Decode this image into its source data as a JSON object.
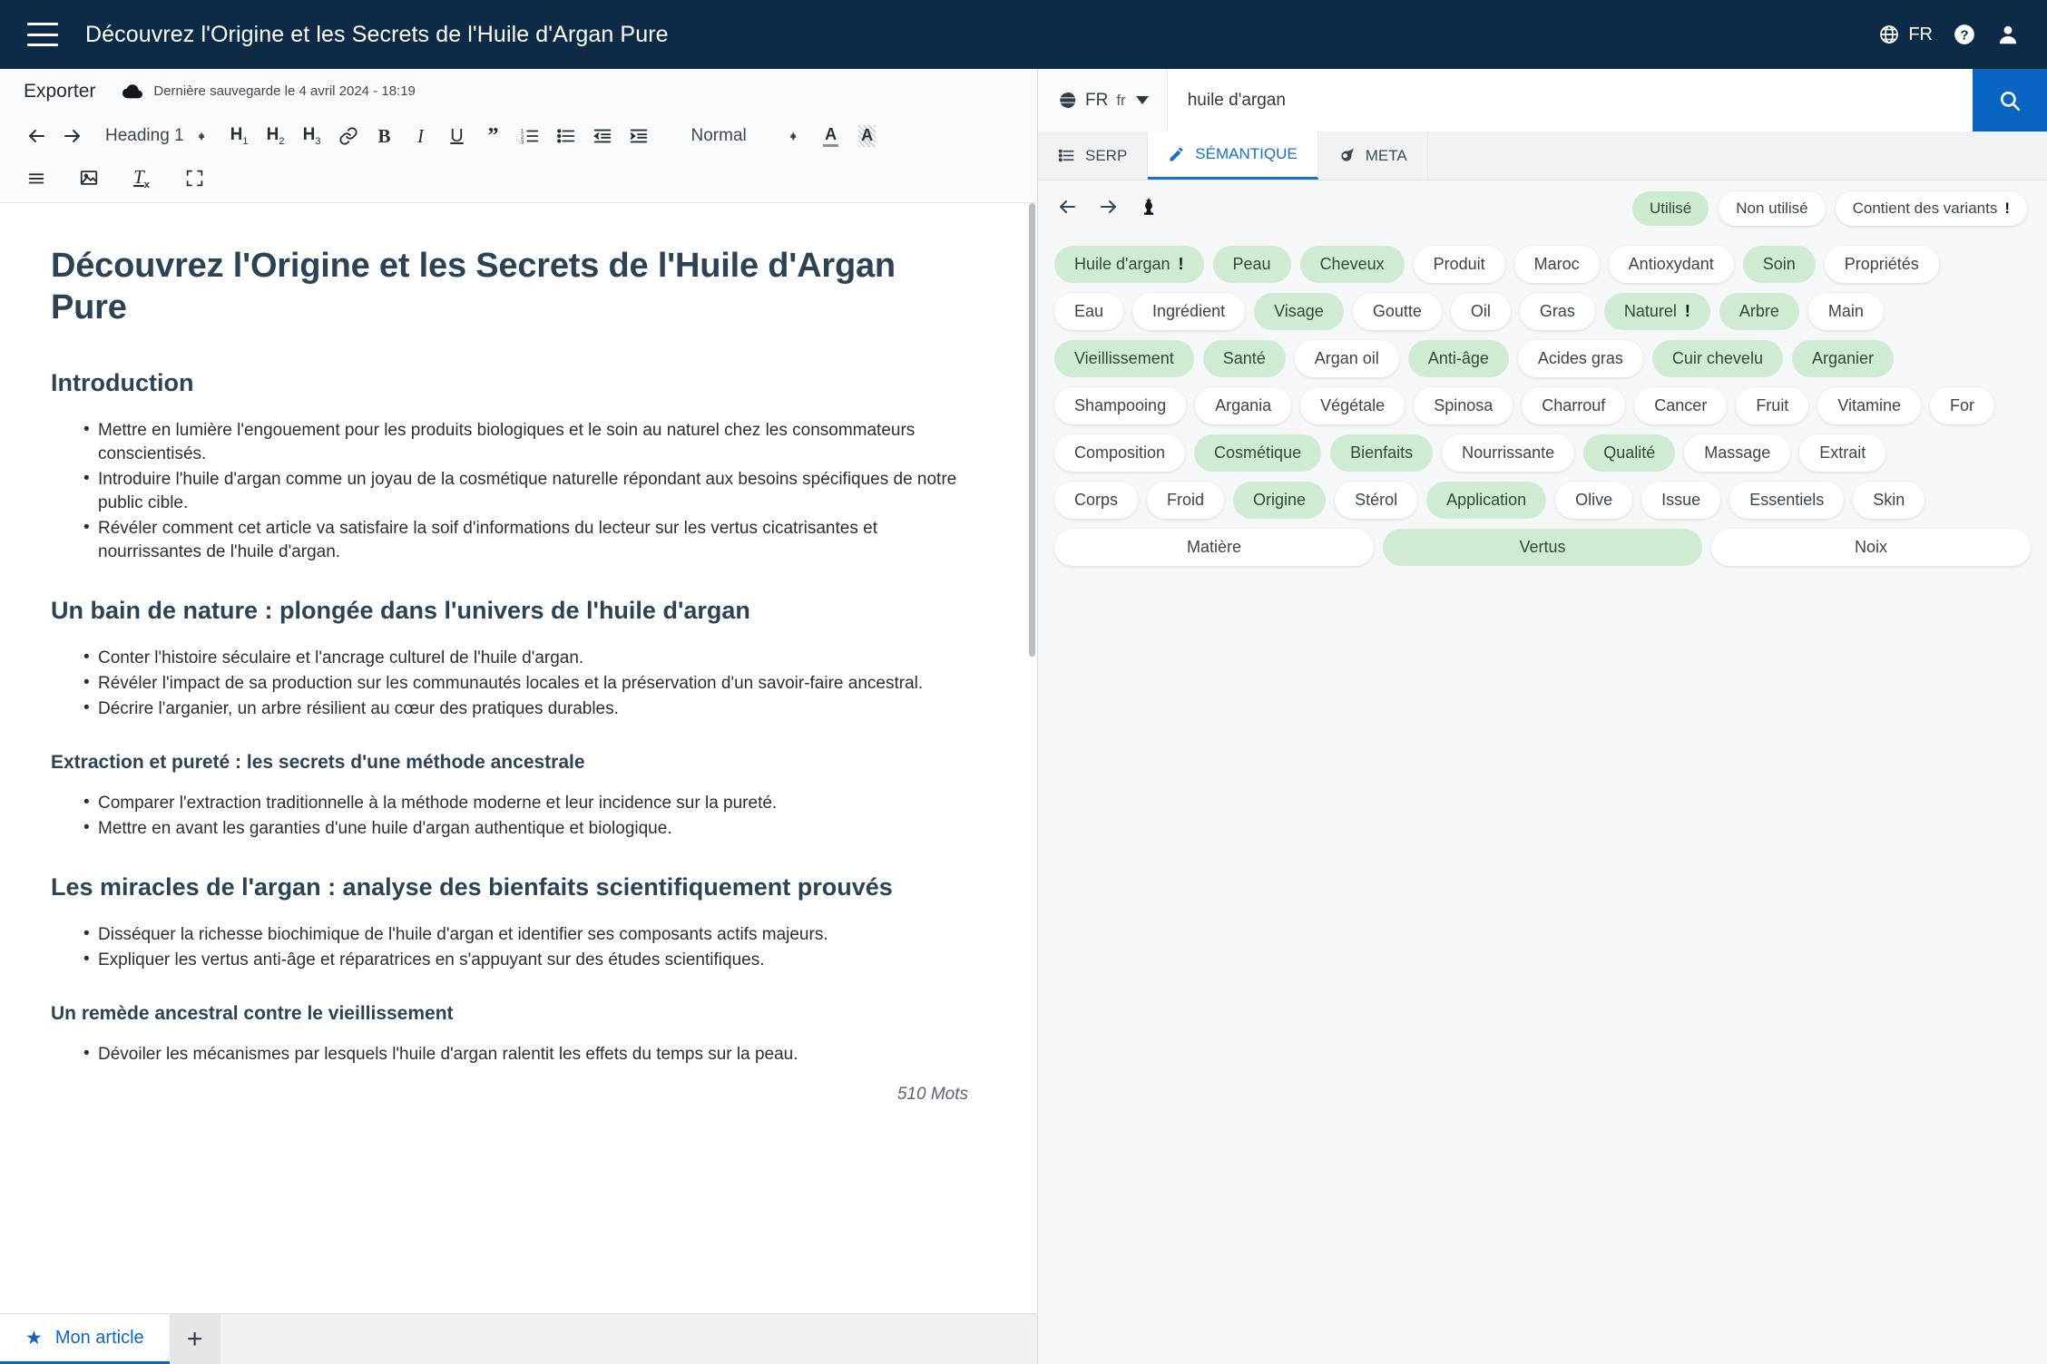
{
  "header": {
    "menu_icon": "hamburger-icon",
    "title": "Découvrez l'Origine et les Secrets de l'Huile d'Argan Pure",
    "lang": "FR",
    "globe_icon": "globe-icon",
    "help_icon": "help-circle-icon",
    "account_icon": "user-icon"
  },
  "editor": {
    "export_label": "Exporter",
    "save_status": "Dernière sauvegarde le 4 avril 2024 - 18:19",
    "cloud_icon": "cloud-icon",
    "toolbar": {
      "undo": "undo-arrow-icon",
      "redo": "redo-arrow-icon",
      "heading_select": "Heading 1",
      "h1": "H1",
      "h2": "H2",
      "h3": "H3",
      "link": "link-icon",
      "bold": "B",
      "italic": "I",
      "underline": "U",
      "quote": "”",
      "ordered_list": "ordered-list-icon",
      "bullet_list": "bullet-list-icon",
      "outdent": "outdent-icon",
      "indent": "indent-icon",
      "format_select": "Normal",
      "text_color": "A",
      "highlight": "A",
      "align": "align-icon",
      "image": "image-icon",
      "clear_format": "clear-format-icon",
      "fullscreen": "fullscreen-icon"
    },
    "document": {
      "title": "Découvrez l'Origine et les Secrets de l'Huile d'Argan Pure",
      "sections": [
        {
          "level": 2,
          "heading": "Introduction",
          "bullets": [
            "Mettre en lumière l'engouement pour les produits biologiques et le soin au naturel chez les consommateurs conscientisés.",
            "Introduire l'huile d'argan comme un joyau de la cosmétique naturelle répondant aux besoins spécifiques de notre public cible.",
            "Révéler comment cet article va satisfaire la soif d'informations du lecteur sur les vertus cicatrisantes et nourrissantes de l'huile d'argan."
          ]
        },
        {
          "level": 2,
          "heading": "Un bain de nature : plongée dans l'univers de l'huile d'argan",
          "bullets": [
            "Conter l'histoire séculaire et l'ancrage culturel de l'huile d'argan.",
            "Révéler l'impact de sa production sur les communautés locales et la préservation d'un savoir-faire ancestral.",
            "Décrire l'arganier, un arbre résilient au cœur des pratiques durables."
          ]
        },
        {
          "level": 3,
          "heading": "Extraction et pureté : les secrets d'une méthode ancestrale",
          "bullets": [
            "Comparer l'extraction traditionnelle à la méthode moderne et leur incidence sur la pureté.",
            "Mettre en avant les garanties d'une huile d'argan authentique et biologique."
          ]
        },
        {
          "level": 2,
          "heading": "Les miracles de l'argan : analyse des bienfaits scientifiquement prouvés",
          "bullets": [
            "Disséquer la richesse biochimique de l'huile d'argan et identifier ses composants actifs majeurs.",
            "Expliquer les vertus anti-âge et réparatrices en s'appuyant sur des études scientifiques."
          ]
        },
        {
          "level": 3,
          "heading": "Un remède ancestral contre le vieillissement",
          "bullets": [
            "Dévoiler les mécanismes par lesquels l'huile d'argan ralentit les effets du temps sur la peau."
          ]
        }
      ],
      "word_count": "510 Mots"
    },
    "tabs": {
      "article_label": "Mon article",
      "star_icon": "star-icon",
      "add_label": "+"
    }
  },
  "panel": {
    "search": {
      "lang_code": "FR",
      "lang_sub": "fr",
      "globe_icon": "globe-icon",
      "query": "huile d'argan",
      "search_icon": "search-icon"
    },
    "tabs": [
      {
        "label": "SERP",
        "icon": "list-icon",
        "active": false
      },
      {
        "label": "SÉMANTIQUE",
        "icon": "pencil-icon",
        "active": true
      },
      {
        "label": "META",
        "icon": "comet-icon",
        "active": false
      }
    ],
    "filters": {
      "back_icon": "arrow-left-icon",
      "forward_icon": "arrow-right-icon",
      "chess_icon": "chess-pawn-icon",
      "chips": [
        {
          "label": "Utilisé",
          "on": true,
          "warn": false
        },
        {
          "label": "Non utilisé",
          "on": false,
          "warn": false
        },
        {
          "label": "Contient des variants",
          "on": false,
          "warn": true
        }
      ]
    },
    "keyword_rows": [
      [
        {
          "label": "Huile d'argan",
          "used": true,
          "warn": true
        },
        {
          "label": "Peau",
          "used": true,
          "warn": false
        },
        {
          "label": "Cheveux",
          "used": true,
          "warn": false
        },
        {
          "label": "Produit",
          "used": false,
          "warn": false
        },
        {
          "label": "Maroc",
          "used": false,
          "warn": false
        },
        {
          "label": "Antioxydant",
          "used": false,
          "warn": false
        },
        {
          "label": "Soin",
          "used": true,
          "warn": false
        },
        {
          "label": "Propriétés",
          "used": false,
          "warn": false
        }
      ],
      [
        {
          "label": "Eau",
          "used": false,
          "warn": false
        },
        {
          "label": "Ingrédient",
          "used": false,
          "warn": false
        },
        {
          "label": "Visage",
          "used": true,
          "warn": false
        },
        {
          "label": "Goutte",
          "used": false,
          "warn": false
        },
        {
          "label": "Oil",
          "used": false,
          "warn": false
        },
        {
          "label": "Gras",
          "used": false,
          "warn": false
        },
        {
          "label": "Naturel",
          "used": true,
          "warn": true
        },
        {
          "label": "Arbre",
          "used": true,
          "warn": false
        },
        {
          "label": "Main",
          "used": false,
          "warn": false
        }
      ],
      [
        {
          "label": "Vieillissement",
          "used": true,
          "warn": false
        },
        {
          "label": "Santé",
          "used": true,
          "warn": false
        },
        {
          "label": "Argan oil",
          "used": false,
          "warn": false
        },
        {
          "label": "Anti-âge",
          "used": true,
          "warn": false
        },
        {
          "label": "Acides gras",
          "used": false,
          "warn": false
        },
        {
          "label": "Cuir chevelu",
          "used": true,
          "warn": false
        },
        {
          "label": "Arganier",
          "used": true,
          "warn": false
        }
      ],
      [
        {
          "label": "Shampooing",
          "used": false,
          "warn": false
        },
        {
          "label": "Argania",
          "used": false,
          "warn": false
        },
        {
          "label": "Végétale",
          "used": false,
          "warn": false
        },
        {
          "label": "Spinosa",
          "used": false,
          "warn": false
        },
        {
          "label": "Charrouf",
          "used": false,
          "warn": false
        },
        {
          "label": "Cancer",
          "used": false,
          "warn": false
        },
        {
          "label": "Fruit",
          "used": false,
          "warn": false
        },
        {
          "label": "Vitamine",
          "used": false,
          "warn": false
        },
        {
          "label": "For",
          "used": false,
          "warn": false
        }
      ],
      [
        {
          "label": "Composition",
          "used": false,
          "warn": false
        },
        {
          "label": "Cosmétique",
          "used": true,
          "warn": false
        },
        {
          "label": "Bienfaits",
          "used": true,
          "warn": false
        },
        {
          "label": "Nourrissante",
          "used": false,
          "warn": false
        },
        {
          "label": "Qualité",
          "used": true,
          "warn": false
        },
        {
          "label": "Massage",
          "used": false,
          "warn": false
        },
        {
          "label": "Extrait",
          "used": false,
          "warn": false
        }
      ],
      [
        {
          "label": "Corps",
          "used": false,
          "warn": false
        },
        {
          "label": "Froid",
          "used": false,
          "warn": false
        },
        {
          "label": "Origine",
          "used": true,
          "warn": false
        },
        {
          "label": "Stérol",
          "used": false,
          "warn": false
        },
        {
          "label": "Application",
          "used": true,
          "warn": false
        },
        {
          "label": "Olive",
          "used": false,
          "warn": false
        },
        {
          "label": "Issue",
          "used": false,
          "warn": false
        },
        {
          "label": "Essentiels",
          "used": false,
          "warn": false
        },
        {
          "label": "Skin",
          "used": false,
          "warn": false
        }
      ],
      [
        {
          "label": "Matière",
          "used": false,
          "warn": false,
          "wide": true
        },
        {
          "label": "Vertus",
          "used": true,
          "warn": false,
          "wide": true
        },
        {
          "label": "Noix",
          "used": false,
          "warn": false,
          "wide": true
        }
      ]
    ]
  },
  "colors": {
    "header_bg": "#0d2b47",
    "accent_blue": "#0a65c2",
    "used_green": "#cfecd2",
    "heading": "#2c4356"
  }
}
